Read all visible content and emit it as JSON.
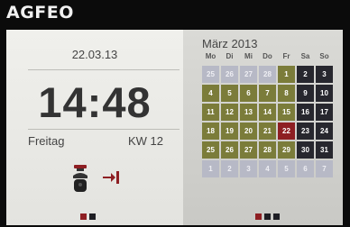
{
  "brand": "AGFEO",
  "clock": {
    "date": "22.03.13",
    "time": "14:48",
    "weekday": "Freitag",
    "week": "KW 12"
  },
  "calendar": {
    "month": "März 2013",
    "weekdays": [
      "Mo",
      "Di",
      "Mi",
      "Do",
      "Fr",
      "Sa",
      "So"
    ],
    "days": [
      {
        "n": "25",
        "s": "faded"
      },
      {
        "n": "26",
        "s": "faded"
      },
      {
        "n": "27",
        "s": "faded"
      },
      {
        "n": "28",
        "s": "faded"
      },
      {
        "n": "1",
        "s": "olive"
      },
      {
        "n": "2",
        "s": "dark"
      },
      {
        "n": "3",
        "s": "dark"
      },
      {
        "n": "4",
        "s": "olive"
      },
      {
        "n": "5",
        "s": "olive"
      },
      {
        "n": "6",
        "s": "olive"
      },
      {
        "n": "7",
        "s": "olive"
      },
      {
        "n": "8",
        "s": "olive"
      },
      {
        "n": "9",
        "s": "dark"
      },
      {
        "n": "10",
        "s": "dark"
      },
      {
        "n": "11",
        "s": "olive"
      },
      {
        "n": "12",
        "s": "olive"
      },
      {
        "n": "13",
        "s": "olive"
      },
      {
        "n": "14",
        "s": "olive"
      },
      {
        "n": "15",
        "s": "olive"
      },
      {
        "n": "16",
        "s": "dark"
      },
      {
        "n": "17",
        "s": "dark"
      },
      {
        "n": "18",
        "s": "olive"
      },
      {
        "n": "19",
        "s": "olive"
      },
      {
        "n": "20",
        "s": "olive"
      },
      {
        "n": "21",
        "s": "olive"
      },
      {
        "n": "22",
        "s": "red"
      },
      {
        "n": "23",
        "s": "dark"
      },
      {
        "n": "24",
        "s": "dark"
      },
      {
        "n": "25",
        "s": "olive"
      },
      {
        "n": "26",
        "s": "olive"
      },
      {
        "n": "27",
        "s": "olive"
      },
      {
        "n": "28",
        "s": "olive"
      },
      {
        "n": "29",
        "s": "olive"
      },
      {
        "n": "30",
        "s": "dark"
      },
      {
        "n": "31",
        "s": "dark"
      },
      {
        "n": "1",
        "s": "faded"
      },
      {
        "n": "2",
        "s": "faded"
      },
      {
        "n": "3",
        "s": "faded"
      },
      {
        "n": "4",
        "s": "faded"
      },
      {
        "n": "5",
        "s": "faded"
      },
      {
        "n": "6",
        "s": "faded"
      },
      {
        "n": "7",
        "s": "faded"
      }
    ]
  },
  "icons": {
    "status": "telephone-icon",
    "forward": "call-forward-icon"
  },
  "pager_left": {
    "count": 2,
    "active": 0
  },
  "pager_right": {
    "count": 3,
    "active": 0
  },
  "colors": {
    "accent_red": "#8e1f23",
    "olive": "#7b7c3a",
    "dark": "#27272e",
    "faded": "#b7b9c6"
  }
}
